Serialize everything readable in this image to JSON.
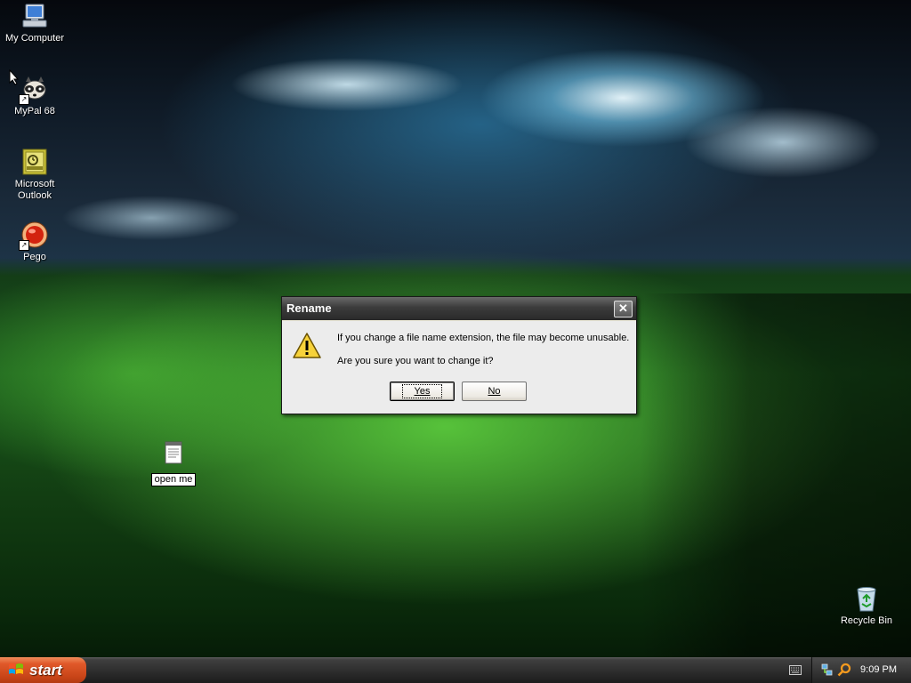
{
  "desktop": {
    "icons": [
      {
        "label": "My Computer"
      },
      {
        "label": "MyPal 68"
      },
      {
        "label": "Microsoft Outlook"
      },
      {
        "label": "Pego"
      },
      {
        "label": "open me"
      },
      {
        "label": "Recycle Bin"
      }
    ]
  },
  "dialog": {
    "title": "Rename",
    "message_line1": "If you change a file name extension, the file may become unusable.",
    "message_line2": "Are you sure you want to change it?",
    "yes_label": "Yes",
    "no_label": "No",
    "close_glyph": "✕"
  },
  "taskbar": {
    "start_label": "start",
    "clock": "9:09 PM"
  }
}
